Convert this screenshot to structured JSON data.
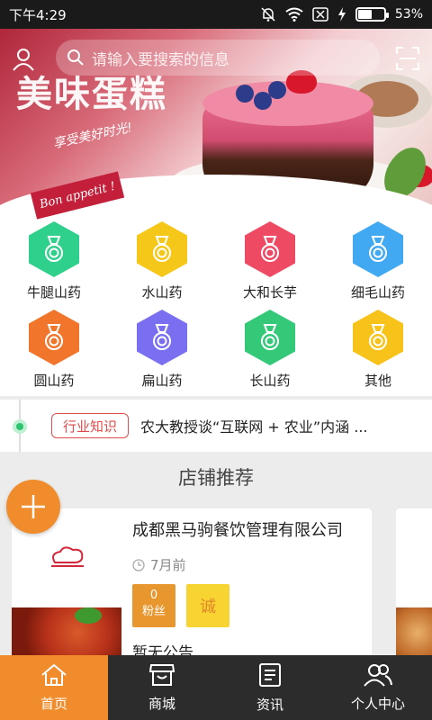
{
  "status_bar": {
    "time": "下午4:29",
    "battery_percent": "53%",
    "battery_level": 0.53
  },
  "banner": {
    "logo_text": "美味蛋糕",
    "slogan": "享受美好时光!",
    "tag": "Bon appetit !"
  },
  "search": {
    "placeholder": "请输入要搜索的信息"
  },
  "categories": [
    {
      "label": "牛腿山药",
      "color": "#2fcf8c",
      "icon": "medal-icon"
    },
    {
      "label": "水山药",
      "color": "#f5c718",
      "icon": "medal-icon"
    },
    {
      "label": "大和长芋",
      "color": "#ef4a63",
      "icon": "medal-icon"
    },
    {
      "label": "细毛山药",
      "color": "#41a9f2",
      "icon": "medal-icon"
    },
    {
      "label": "圆山药",
      "color": "#f2752c",
      "icon": "medal-icon"
    },
    {
      "label": "扁山药",
      "color": "#7a6ff0",
      "icon": "medal-icon"
    },
    {
      "label": "长山药",
      "color": "#33c979",
      "icon": "medal-icon"
    },
    {
      "label": "其他",
      "color": "#f7c21a",
      "icon": "medal-icon"
    }
  ],
  "news": {
    "badge": "行业知识",
    "title": "农大教授谈“互联网 + 农业”内涵 ..."
  },
  "shops": {
    "section_title": "店铺推荐",
    "card": {
      "name": "成都黑马驹餐饮管理有限公司",
      "time": "7月前",
      "fans_count": "0",
      "fans_label": "粉丝",
      "cheng": "诚",
      "notice": "暂无公告"
    }
  },
  "nav": {
    "items": [
      {
        "label": "首页",
        "icon": "home-icon",
        "active": true
      },
      {
        "label": "商城",
        "icon": "store-icon",
        "active": false
      },
      {
        "label": "资讯",
        "icon": "news-icon",
        "active": false
      },
      {
        "label": "个人中心",
        "icon": "profile-icon",
        "active": false
      }
    ]
  },
  "colors": {
    "accent": "#f08c2b",
    "nav_bg": "#2c2c2c",
    "badge_red": "#e24b4b"
  }
}
